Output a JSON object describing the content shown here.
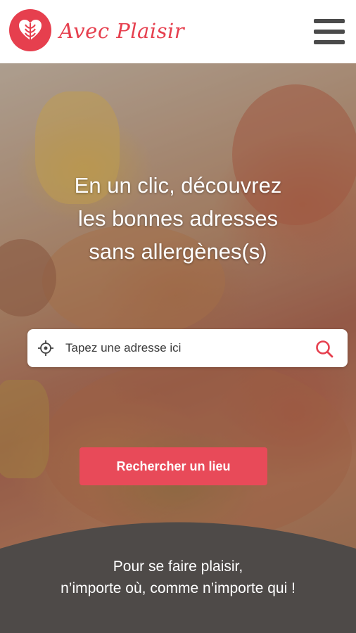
{
  "header": {
    "brand_name": "Avec Plaisir",
    "logo_icon": "heart-wheat-icon",
    "menu_icon": "hamburger-menu-icon"
  },
  "hero": {
    "headline_lines": [
      "En un clic, découvrez",
      "les bonnes adresses",
      "sans allergènes(s)"
    ],
    "background": "pizza-table-photo"
  },
  "search": {
    "placeholder": "Tapez une adresse ici",
    "value": "",
    "locate_icon": "crosshair-location-icon",
    "search_icon": "search-icon"
  },
  "cta": {
    "label": "Rechercher un lieu"
  },
  "footer": {
    "tagline_lines": [
      "Pour se faire plaisir,",
      "n’importe où, comme n’importe qui !"
    ]
  },
  "colors": {
    "brand": "#e63f4e",
    "cta": "#e84a59",
    "footer": "#4e4a48",
    "menu": "#4a4a4a"
  }
}
